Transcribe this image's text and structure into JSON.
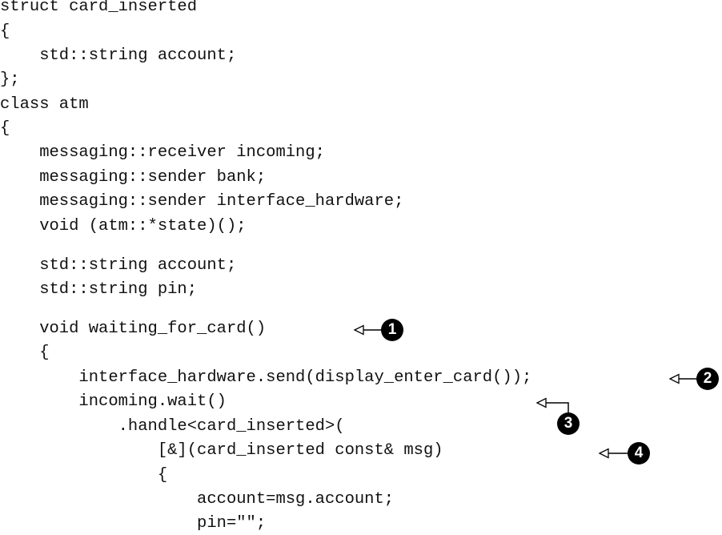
{
  "code": {
    "lines": [
      "struct card_inserted",
      "{",
      "    std::string account;",
      "};",
      "class atm",
      "{",
      "    messaging::receiver incoming;",
      "    messaging::sender bank;",
      "    messaging::sender interface_hardware;",
      "    void (atm::*state)();",
      "    std::string account;",
      "    std::string pin;",
      "    void waiting_for_card()",
      "    {",
      "        interface_hardware.send(display_enter_card());",
      "        incoming.wait()",
      "            .handle<card_inserted>(",
      "                [&](card_inserted const& msg)",
      "                {",
      "                    account=msg.account;",
      "                    pin=\"\";"
    ]
  },
  "callouts": [
    {
      "number": "1"
    },
    {
      "number": "2"
    },
    {
      "number": "3"
    },
    {
      "number": "4"
    }
  ]
}
